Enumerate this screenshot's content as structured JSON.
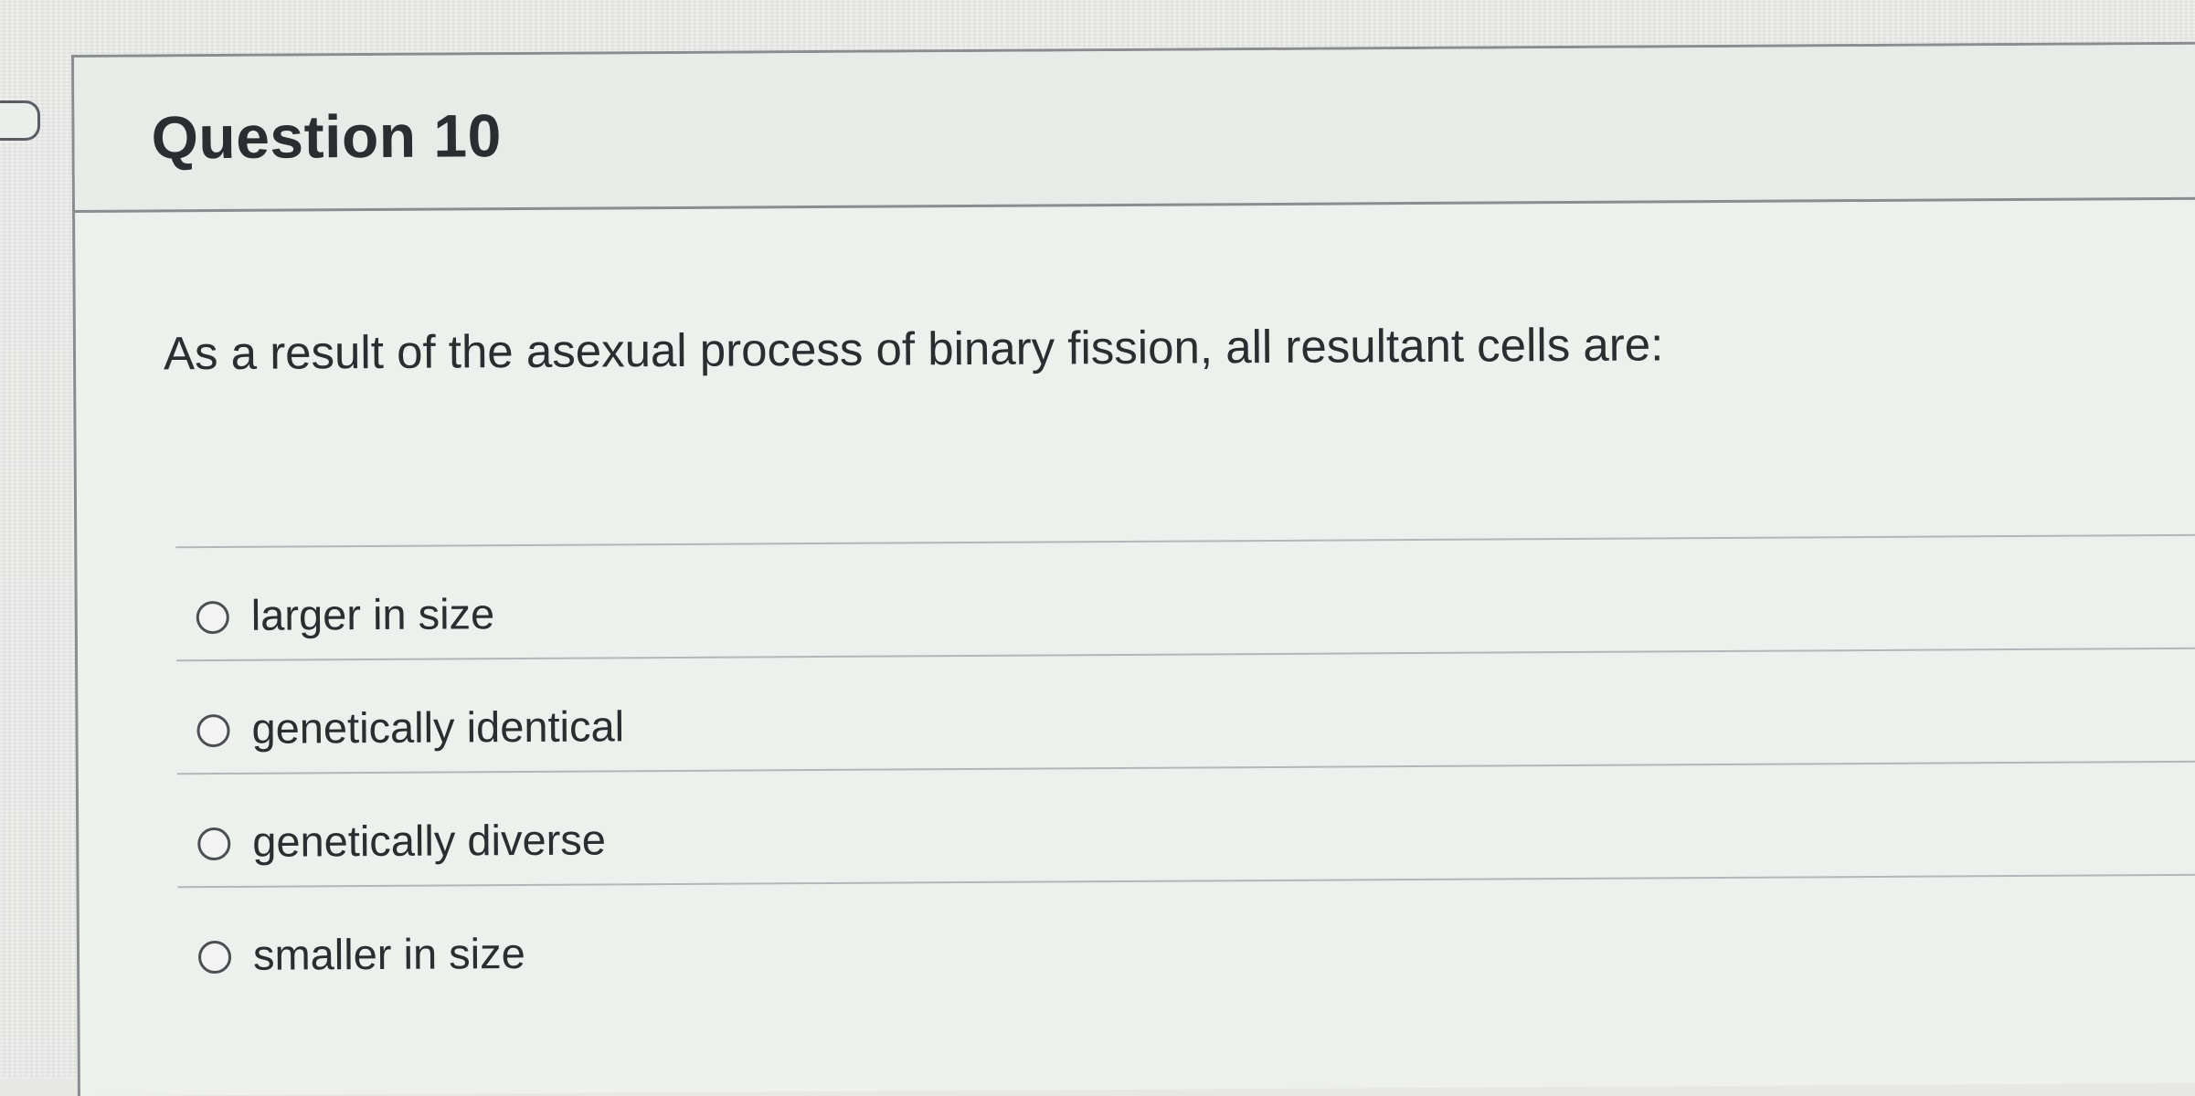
{
  "question": {
    "title": "Question 10",
    "text": "As a result of the asexual process of binary fission, all resultant cells are:"
  },
  "answers": [
    {
      "label": "larger in size",
      "selected": false
    },
    {
      "label": "genetically identical",
      "selected": false
    },
    {
      "label": "genetically diverse",
      "selected": false
    },
    {
      "label": "smaller in size",
      "selected": false
    }
  ],
  "icons": {
    "flag": "flag-marker-icon",
    "radio": "radio-unselected-icon",
    "corner": "caret-down-icon"
  }
}
